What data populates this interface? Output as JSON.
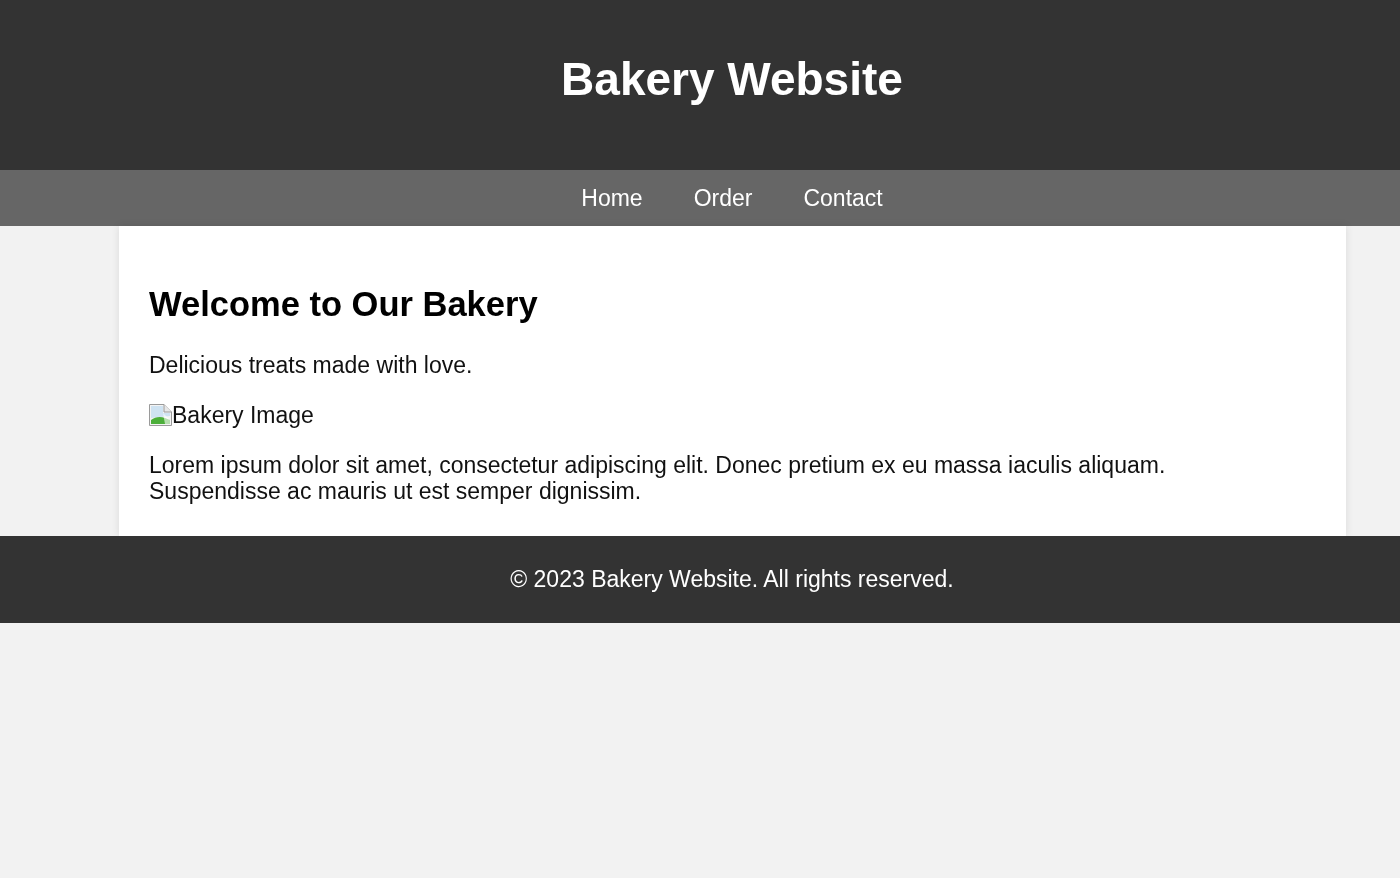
{
  "header": {
    "title": "Bakery Website"
  },
  "nav": {
    "links": [
      {
        "label": "Home"
      },
      {
        "label": "Order"
      },
      {
        "label": "Contact"
      }
    ]
  },
  "main": {
    "heading": "Welcome to Our Bakery",
    "tagline": "Delicious treats made with love.",
    "image": {
      "alt": "Bakery Image"
    },
    "body": "Lorem ipsum dolor sit amet, consectetur adipiscing elit. Donec pretium ex eu massa iaculis aliquam. Suspendisse ac mauris ut est semper dignissim."
  },
  "footer": {
    "text": "© 2023 Bakery Website. All rights reserved."
  }
}
